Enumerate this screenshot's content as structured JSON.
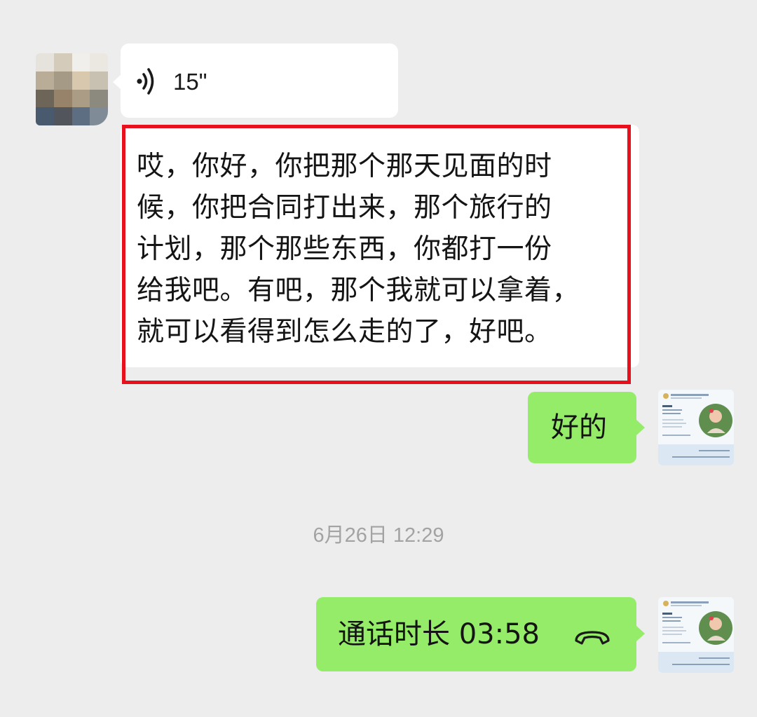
{
  "chat": {
    "messages": [
      {
        "type": "voice",
        "direction": "incoming",
        "duration": "15\""
      },
      {
        "type": "transcription",
        "direction": "incoming",
        "highlighted": true,
        "text": "哎，你好，你把那个那天见面的时\n候，你把合同打出来，那个旅行的\n计划，那个那些东西，你都打一份\n给我吧。有吧，那个我就可以拿着，\n就可以看得到怎么走的了，好吧。"
      },
      {
        "type": "text",
        "direction": "outgoing",
        "text": "好的"
      },
      {
        "type": "call",
        "direction": "outgoing",
        "text": "通话时长 03:58"
      }
    ],
    "timestamp": "6月26日 12:29"
  },
  "colors": {
    "background": "#ededed",
    "incoming_bubble": "#ffffff",
    "outgoing_bubble": "#95ec69",
    "highlight_border": "#e8101d",
    "timestamp_text": "#a3a3a3"
  },
  "icons": {
    "voice": "voice-wave-icon",
    "call": "phone-hangup-icon"
  }
}
